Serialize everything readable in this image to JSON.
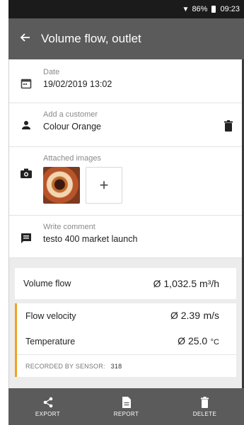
{
  "status_bar": {
    "battery": "86%",
    "time": "09:23"
  },
  "app_bar": {
    "title": "Volume flow, outlet"
  },
  "details": {
    "date": {
      "label": "Date",
      "value": "19/02/2019 13:02"
    },
    "customer": {
      "label": "Add a customer",
      "value": "Colour Orange"
    },
    "images": {
      "label": "Attached images",
      "add_symbol": "+"
    },
    "comment": {
      "label": "Write comment",
      "value": "testo 400 market launch"
    }
  },
  "measurements": {
    "volume_flow": {
      "name": "Volume flow",
      "value": "Ø 1,032.5 m³/h"
    },
    "recorded": {
      "rows": [
        {
          "name": "Flow velocity",
          "value": "Ø 2.39",
          "unit": "m/s"
        },
        {
          "name": "Temperature",
          "value": "Ø 25.0",
          "unit": "°C"
        }
      ],
      "footer_label": "RECORDED BY SENSOR:",
      "sensor_number": "318",
      "accent_color": "#f0a21e"
    }
  },
  "bottom_bar": {
    "export": "EXPORT",
    "report": "REPORT",
    "delete": "DELETE"
  },
  "colors": {
    "app_bar": "#5b5b5b",
    "status_bar": "#1b1b1b",
    "background_grey": "#ececec"
  }
}
